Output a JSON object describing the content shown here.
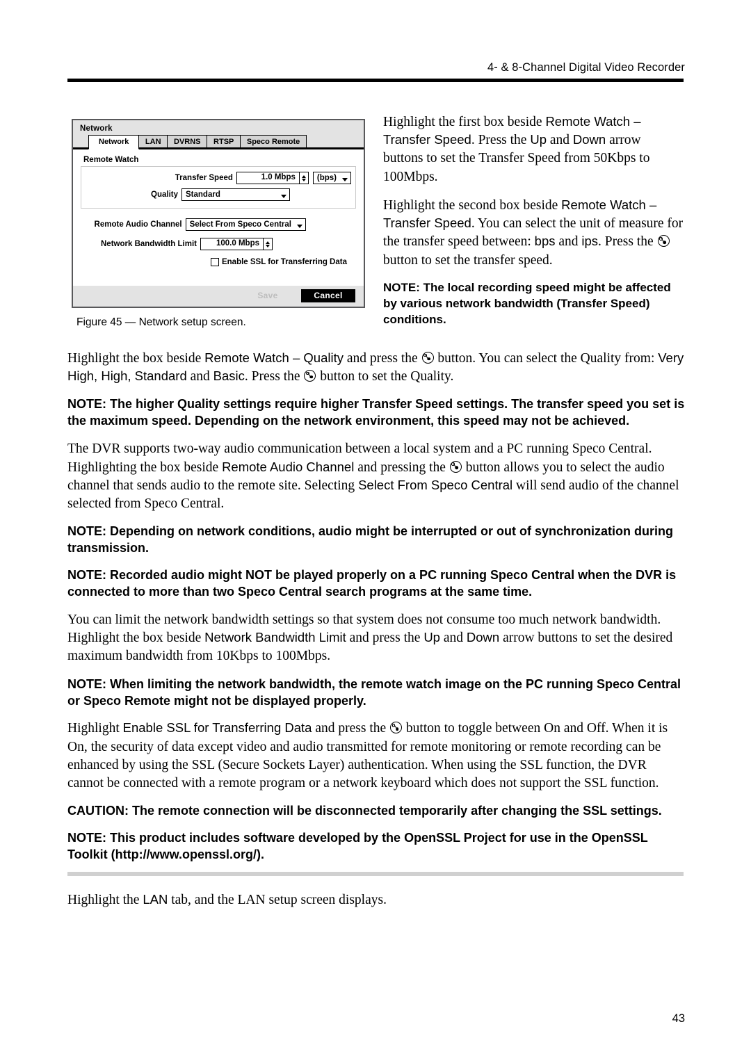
{
  "header": {
    "title": "4- & 8-Channel Digital Video Recorder"
  },
  "figure": {
    "caption": "Figure 45 — Network setup screen.",
    "dialog": {
      "title": "Network",
      "tabs": [
        {
          "label": "Network",
          "active": true
        },
        {
          "label": "LAN",
          "active": false
        },
        {
          "label": "DVRNS",
          "active": false
        },
        {
          "label": "RTSP",
          "active": false
        },
        {
          "label": "Speco Remote",
          "active": false
        }
      ],
      "group_label": "Remote Watch",
      "fields": {
        "transfer_speed_label": "Transfer Speed",
        "transfer_speed_value": "1.0 Mbps",
        "transfer_speed_unit": "(bps)",
        "quality_label": "Quality",
        "quality_value": "Standard",
        "remote_audio_channel_label": "Remote Audio Channel",
        "remote_audio_channel_value": "Select From Speco Central",
        "network_bandwidth_limit_label": "Network Bandwidth Limit",
        "network_bandwidth_limit_value": "100.0 Mbps",
        "enable_ssl_label": "Enable SSL for Transferring Data",
        "enable_ssl_checked": false
      },
      "buttons": {
        "save": "Save",
        "cancel": "Cancel"
      }
    }
  },
  "right_column": {
    "para1_a": "Highlight the first box beside ",
    "para1_ui1": "Remote Watch – Transfer Speed",
    "para1_b": ". Press the ",
    "para1_ui2": "Up",
    "para1_c": " and ",
    "para1_ui3": "Down",
    "para1_d": " arrow buttons to set the Transfer Speed from 50Kbps to 100Mbps.",
    "para2_a": "Highlight the second box beside ",
    "para2_ui1": "Remote Watch – Transfer Speed",
    "para2_b": ". You can select the unit of measure for the transfer speed between: ",
    "para2_ui2": "bps",
    "para2_c": " and ",
    "para2_ui3": "ips",
    "para2_d": ". Press the ",
    "para2_e": " button to set the transfer speed.",
    "note1": "NOTE:  The local recording speed might be affected by various network bandwidth (Transfer Speed) conditions."
  },
  "main_column": {
    "para3_a": "Highlight the box beside ",
    "para3_ui1": "Remote Watch – Quality",
    "para3_b": " and press the ",
    "para3_c": " button.  You can select the Quality from: ",
    "para3_ui2": "Very High, High, Standard",
    "para3_d": " and ",
    "para3_ui3": "Basic",
    "para3_e": ".  Press the ",
    "para3_f": " button to set the Quality.",
    "note2": "NOTE:  The higher Quality settings require higher Transfer Speed settings.  The transfer speed you set is the maximum speed.  Depending on the network environment, this speed may not be achieved.",
    "para4_a": "The DVR supports two-way audio communication between a local system and a PC running Speco Central.  Highlighting the box beside ",
    "para4_ui1": "Remote Audio Channel",
    "para4_b": " and pressing the ",
    "para4_c": " button allows you to select the audio channel that sends audio to the remote site.  Selecting ",
    "para4_ui2": "Select From Speco Central",
    "para4_d": " will send audio of the channel selected from Speco Central.",
    "note3": "NOTE:  Depending on network conditions, audio might be interrupted or out of synchronization during transmission.",
    "note4": "NOTE:  Recorded audio might NOT be played properly on a PC running Speco Central when the DVR is connected to more than two Speco Central search programs at the same time.",
    "para5_a": "You can limit the network bandwidth settings so that system does not consume too much network bandwidth.  Highlight the box beside ",
    "para5_ui1": "Network Bandwidth Limit",
    "para5_b": " and press the ",
    "para5_ui2": "Up",
    "para5_c": " and ",
    "para5_ui3": "Down",
    "para5_d": " arrow buttons to set the desired maximum bandwidth from 10Kbps to 100Mbps.",
    "note5": "NOTE:  When limiting the network bandwidth, the remote watch image on the PC running Speco Central or Speco Remote might not be displayed properly.",
    "para6_a": "Highlight ",
    "para6_ui1": "Enable SSL for Transferring Data",
    "para6_b": " and press the ",
    "para6_c": " button to toggle between On and Off.  When it is On, the security of data except video and audio transmitted for remote monitoring or remote recording can be enhanced by using the SSL (Secure Sockets Layer) authentication.  When using the SSL function, the DVR cannot be connected with a remote program or a network keyboard which does not support the SSL function.",
    "caution1": "CAUTION:  The remote connection will be disconnected temporarily after changing the SSL settings.",
    "note6": "NOTE:  This product includes software developed by the OpenSSL Project for use in the OpenSSL Toolkit (http://www.openssl.org/).",
    "para7_a": "Highlight the ",
    "para7_ui1": "LAN",
    "para7_b": " tab, and the LAN setup screen displays."
  },
  "page_number": "43"
}
